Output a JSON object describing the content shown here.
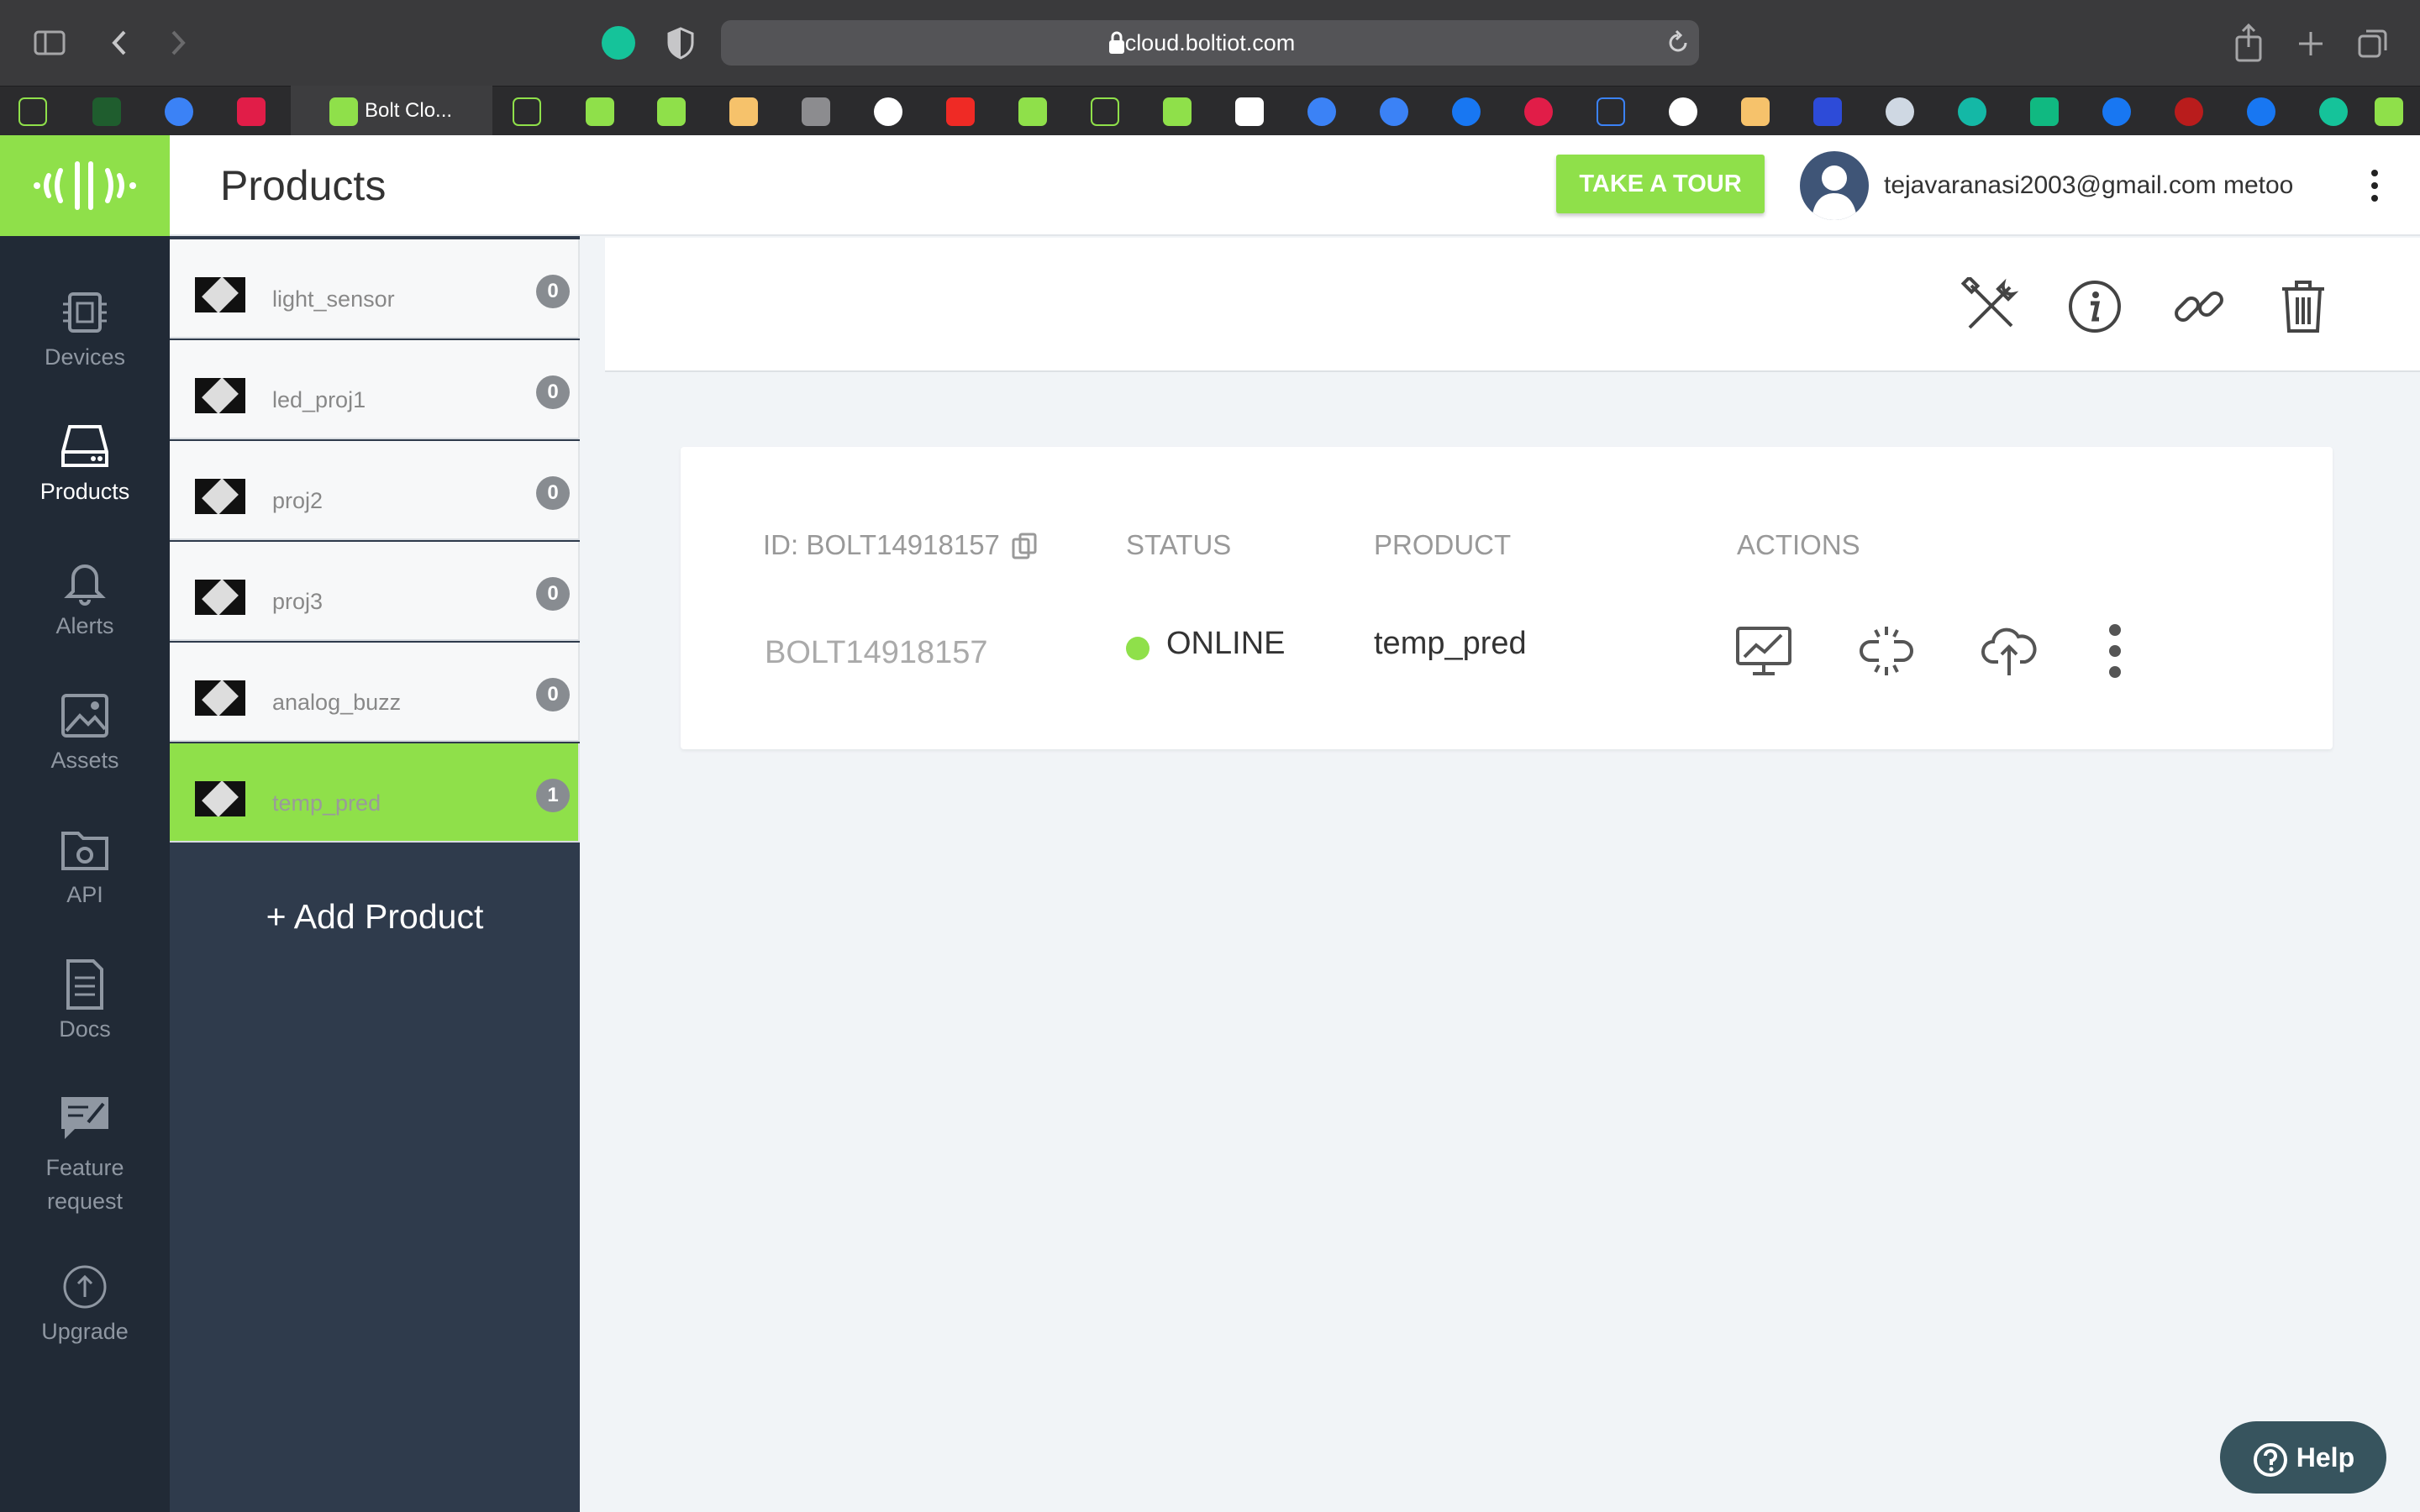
{
  "browser": {
    "url": "cloud.boltiot.com",
    "active_tab_label": "Bolt Clo..."
  },
  "header": {
    "title": "Products",
    "tour_button": "TAKE A TOUR",
    "user_label": "tejavaranasi2003@gmail.com metoo"
  },
  "nav": {
    "devices": "Devices",
    "products": "Products",
    "alerts": "Alerts",
    "assets": "Assets",
    "api": "API",
    "docs": "Docs",
    "feature_line1": "Feature",
    "feature_line2": "request",
    "upgrade": "Upgrade"
  },
  "products": [
    {
      "name": "light_sensor",
      "count": "0"
    },
    {
      "name": "led_proj1",
      "count": "0"
    },
    {
      "name": "proj2",
      "count": "0"
    },
    {
      "name": "proj3",
      "count": "0"
    },
    {
      "name": "analog_buzz",
      "count": "0"
    },
    {
      "name": "temp_pred",
      "count": "1"
    }
  ],
  "add_product": "+ Add Product",
  "device_table": {
    "headers": {
      "id": "ID: BOLT14918157",
      "status": "STATUS",
      "product": "PRODUCT",
      "actions": "ACTIONS"
    },
    "row": {
      "id": "BOLT14918157",
      "status": "ONLINE",
      "product": "temp_pred"
    }
  },
  "help": "Help",
  "colors": {
    "accent": "#8fe04a",
    "online": "#8fe04a",
    "sidebar": "#212a36"
  }
}
